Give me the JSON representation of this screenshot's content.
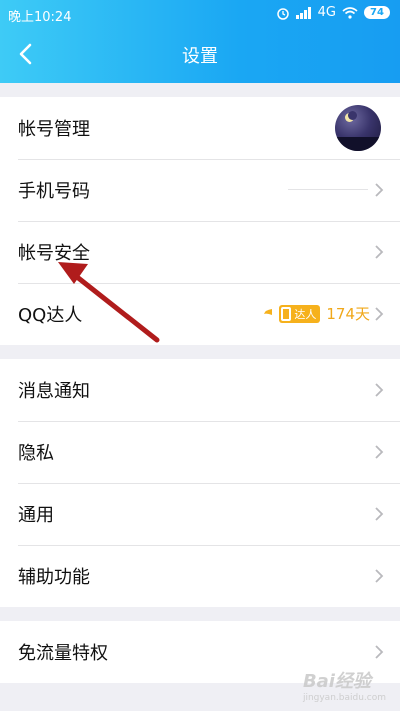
{
  "status_bar": {
    "time": "晚上10:24",
    "network": "4G",
    "battery": "74"
  },
  "nav": {
    "title": "设置"
  },
  "groups": [
    {
      "items": [
        {
          "label": "帐号管理"
        },
        {
          "label": "手机号码"
        },
        {
          "label": "帐号安全"
        },
        {
          "label": "QQ达人",
          "badge": "达人",
          "days": "174天"
        }
      ]
    },
    {
      "items": [
        {
          "label": "消息通知"
        },
        {
          "label": "隐私"
        },
        {
          "label": "通用"
        },
        {
          "label": "辅助功能"
        }
      ]
    },
    {
      "items": [
        {
          "label": "免流量特权"
        }
      ]
    }
  ],
  "watermark": {
    "text": "Bai经验",
    "sub": "jingyan.baidu.com"
  },
  "colors": {
    "header_start": "#3ecbf6",
    "header_end": "#179df2",
    "accent_orange": "#f0a81b",
    "annotation_arrow": "#b01c1c"
  }
}
